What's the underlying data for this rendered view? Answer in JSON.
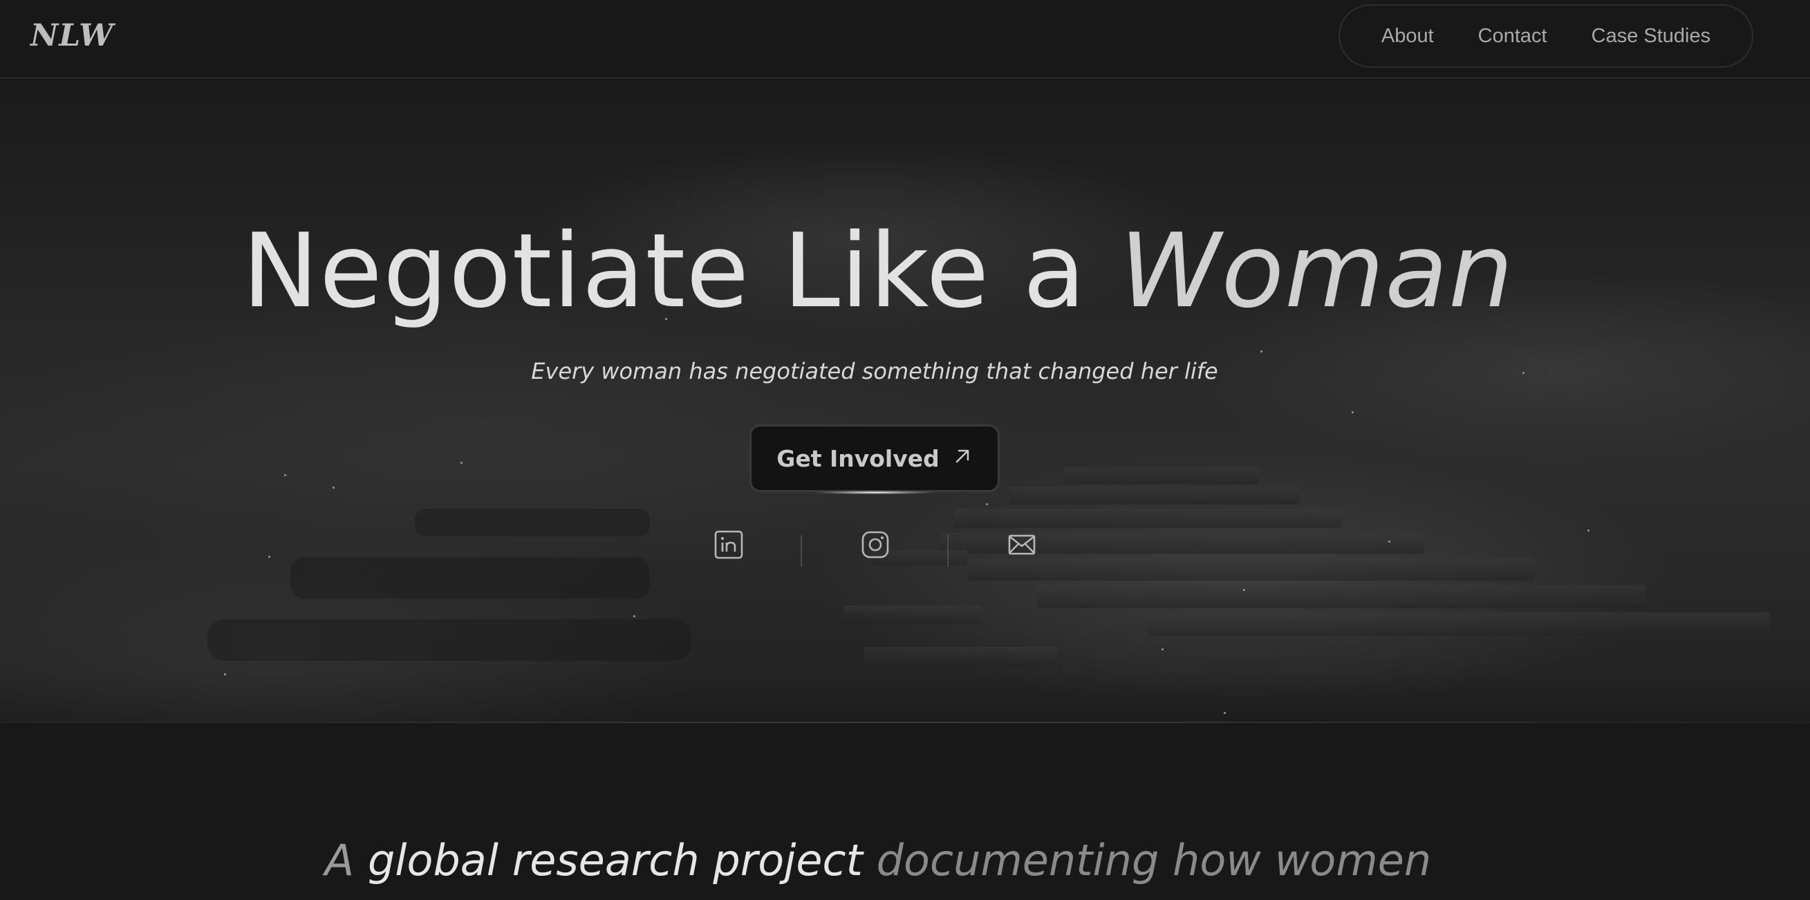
{
  "header": {
    "logo": "NLW",
    "nav": [
      {
        "label": "About"
      },
      {
        "label": "Contact"
      },
      {
        "label": "Case Studies"
      }
    ]
  },
  "hero": {
    "title_main": "Negotiate Like a",
    "title_italic": "Woman",
    "subtitle": "Every woman has negotiated something that changed her life",
    "cta_label": "Get Involved",
    "cta_icon": "arrow-up-right-icon",
    "social": [
      {
        "icon": "linkedin-icon"
      },
      {
        "icon": "instagram-icon"
      },
      {
        "icon": "mail-icon"
      }
    ]
  },
  "tagline": {
    "part1": "A",
    "part2": "global research project",
    "part3": "documenting how women"
  },
  "colors": {
    "background": "#181818",
    "text_primary": "#e2e2e2",
    "text_muted": "#a9a9a9"
  }
}
